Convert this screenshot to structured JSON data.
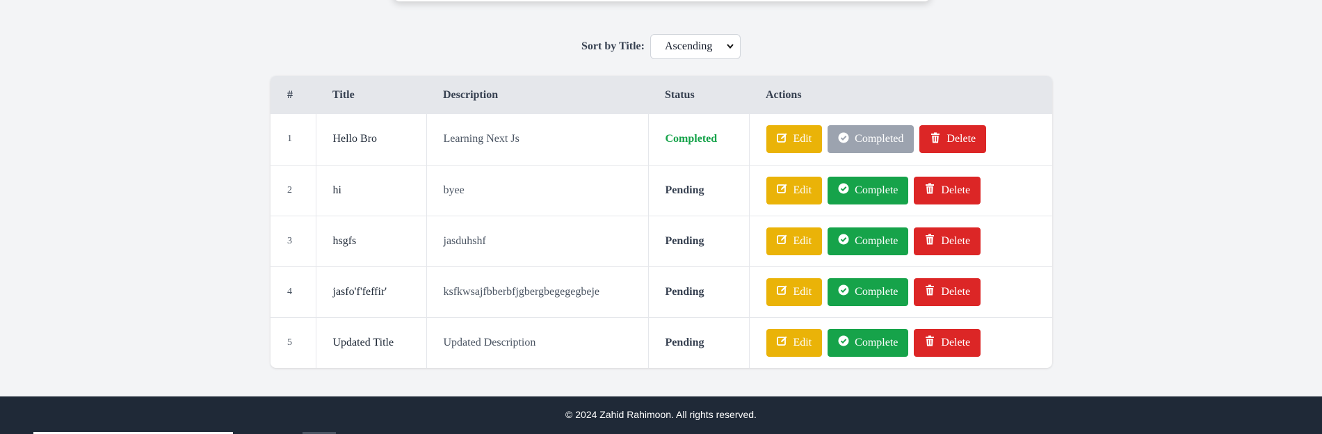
{
  "sort": {
    "label": "Sort by Title:",
    "selected": "Ascending"
  },
  "table": {
    "headers": [
      "#",
      "Title",
      "Description",
      "Status",
      "Actions"
    ],
    "rows": [
      {
        "num": "1",
        "title": "Hello Bro",
        "description": "Learning Next Js",
        "status": "Completed",
        "edit": "Edit",
        "complete": "Completed",
        "delete": "Delete"
      },
      {
        "num": "2",
        "title": "hi",
        "description": "byee",
        "status": "Pending",
        "edit": "Edit",
        "complete": "Complete",
        "delete": "Delete"
      },
      {
        "num": "3",
        "title": "hsgfs",
        "description": "jasduhshf",
        "status": "Pending",
        "edit": "Edit",
        "complete": "Complete",
        "delete": "Delete"
      },
      {
        "num": "4",
        "title": "jasfo'f'feffir'",
        "description": "ksfkwsajfbberbfjgbergbegegegbeje",
        "status": "Pending",
        "edit": "Edit",
        "complete": "Complete",
        "delete": "Delete"
      },
      {
        "num": "5",
        "title": "Updated Title",
        "description": "Updated Description",
        "status": "Pending",
        "edit": "Edit",
        "complete": "Complete",
        "delete": "Delete"
      }
    ]
  },
  "footer": {
    "text": "© 2024 Zahid Rahimoon. All rights reserved."
  },
  "icons": {
    "edit": "edit-icon",
    "complete": "check-circle-icon",
    "delete": "trash-icon",
    "sort_chevron": "chevron-down-icon"
  },
  "colors": {
    "edit": "#eab308",
    "complete": "#16a34a",
    "completed_disabled": "#9ca3af",
    "delete": "#dc2626",
    "status_completed": "#16a34a",
    "footer_bg": "#1f2937"
  }
}
